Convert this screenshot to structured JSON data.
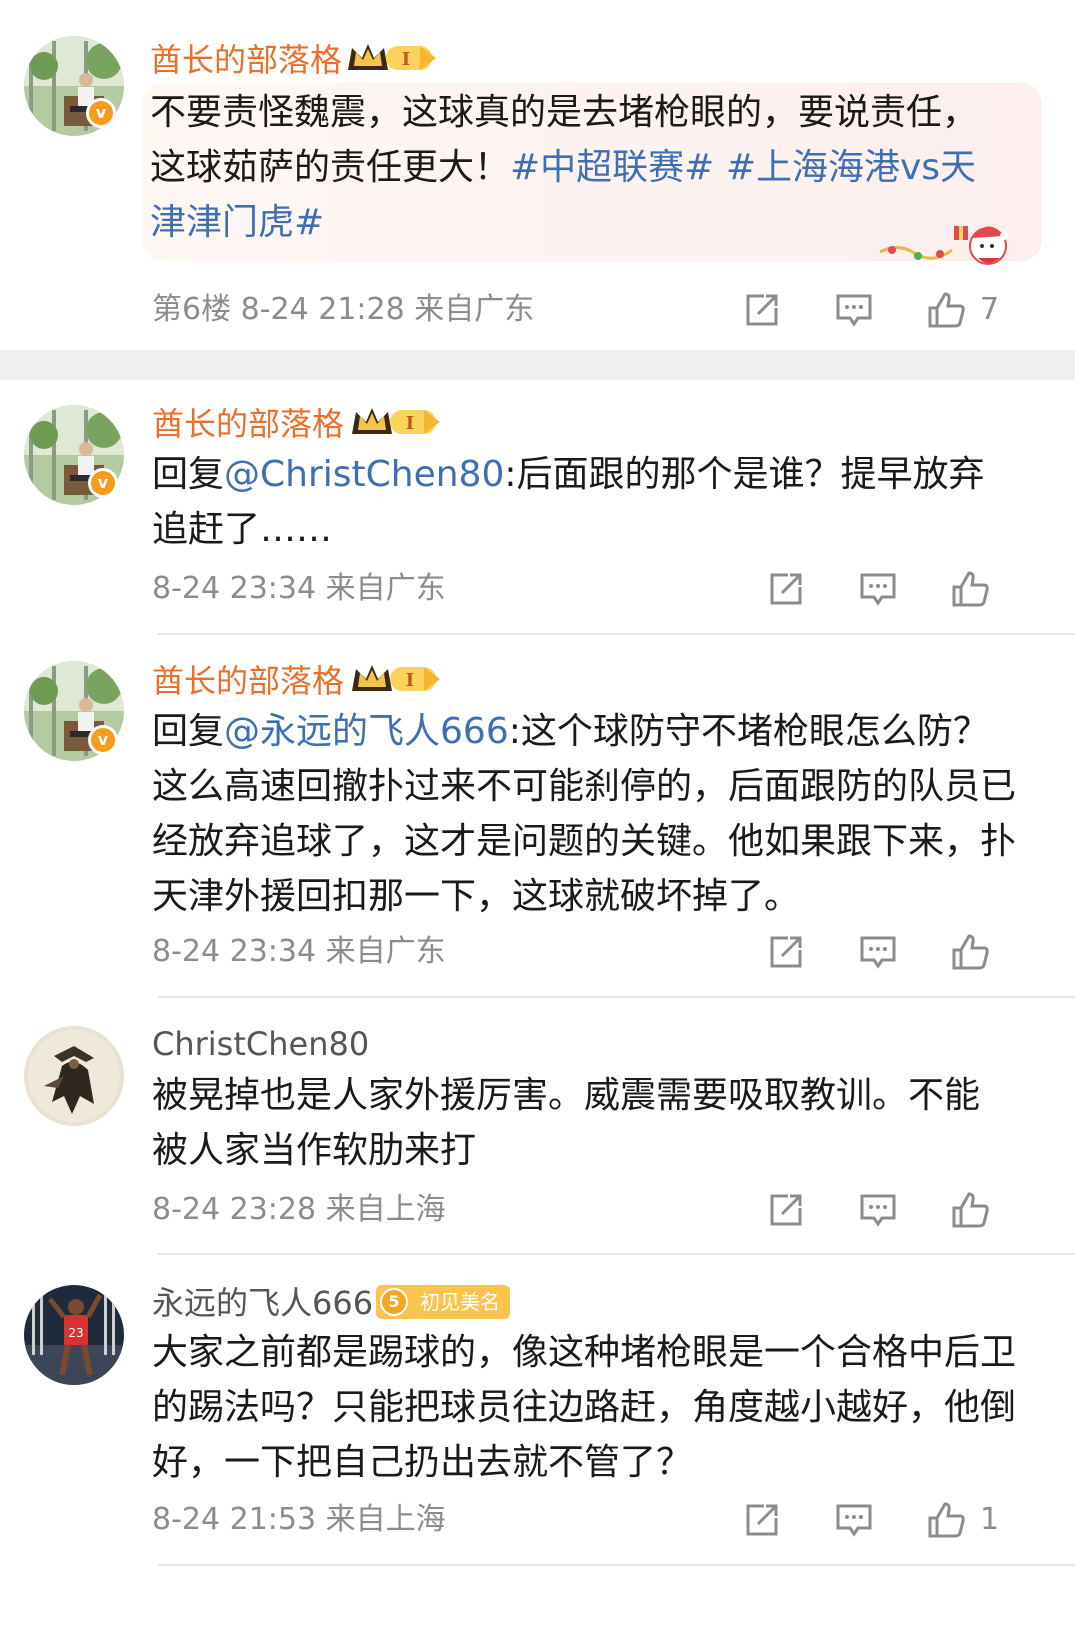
{
  "comments": [
    {
      "username": "酋长的部落格",
      "text_plain": "不要责怪魏震，这球真的是去堵枪眼的，要说责任，这球茹萨的责任更大！",
      "topic1": "#中超联赛#",
      "topic2": "#上海海港vs天津津门虎#",
      "meta": "第6楼 8-24 21:28 来自广东",
      "likes": "7"
    },
    {
      "username": "酋长的部落格",
      "reply_prefix": "回复",
      "mention": "@ChristChen80",
      "text": ":后面跟的那个是谁？提早放弃追赶了……",
      "meta": "8-24 23:34 来自广东"
    },
    {
      "username": "酋长的部落格",
      "reply_prefix": "回复",
      "mention": "@永远的飞人666",
      "text": ":这个球防守不堵枪眼怎么防？这么高速回撤扑过来不可能刹停的，后面跟防的队员已经放弃追球了，这才是问题的关键。他如果跟下来，扑天津外援回扣那一下，这球就破坏掉了。",
      "meta": "8-24 23:34 来自广东"
    },
    {
      "username": "ChristChen80",
      "text": "被晃掉也是人家外援厉害。威震需要吸取教训。不能被人家当作软肋来打",
      "meta": "8-24 23:28 来自上海"
    },
    {
      "username": "永远的飞人666",
      "badge_level": "5",
      "badge_label": "初见美名",
      "text": "大家之前都是踢球的，像这种堵枪眼是一个合格中后卫的踢法吗？只能把球员往边路赶，角度越小越好，他倒好，一下把自己扔出去就不管了？",
      "meta": "8-24 21:53 来自上海",
      "likes": "1"
    }
  ],
  "icons": {
    "repost": "repost-icon",
    "comment": "comment-icon",
    "like": "thumbs-up-icon",
    "crown": "vip-crown-badge",
    "verified": "verified-v-badge"
  },
  "verified_glyph": "v",
  "crown_level": "I",
  "colors": {
    "username_vip": "#e8702a",
    "link": "#3f6fb2",
    "meta": "#8c8c8c"
  }
}
